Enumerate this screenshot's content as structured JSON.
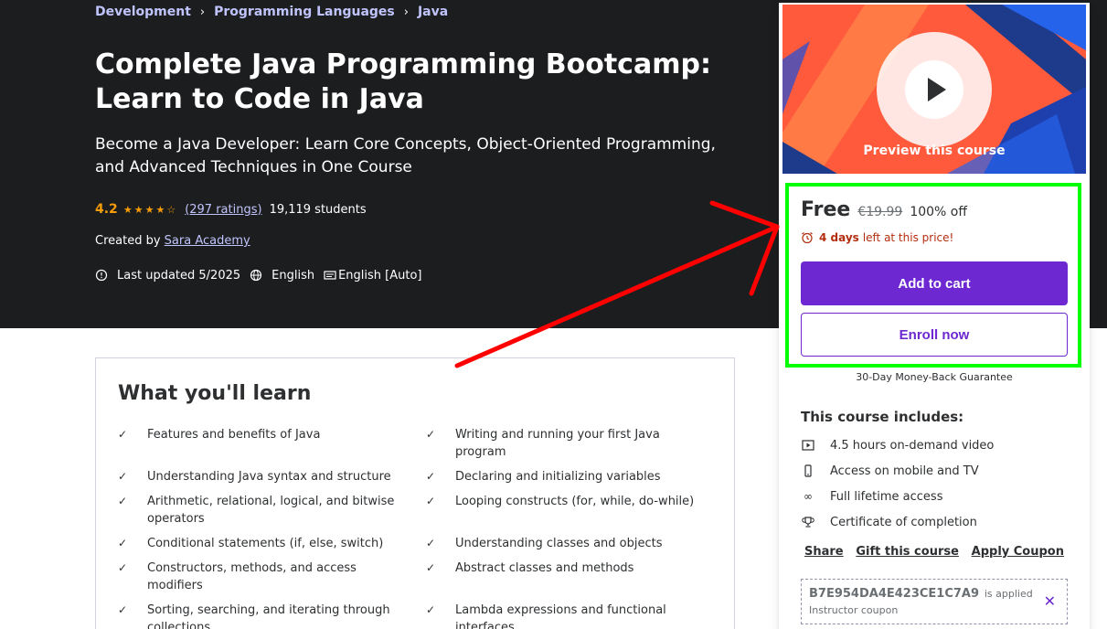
{
  "breadcrumb": [
    "Development",
    "Programming Languages",
    "Java"
  ],
  "course": {
    "title": "Complete Java Programming Bootcamp: Learn to Code in Java",
    "subtitle": "Become a Java Developer: Learn Core Concepts, Object-Oriented Programming, and Advanced Techniques in One Course",
    "rating": "4.2",
    "ratings_link": "(297 ratings)",
    "students": "19,119 students",
    "created_by_label": "Created by",
    "author": "Sara Academy",
    "updated": "Last updated 5/2025",
    "language": "English",
    "captions": "English [Auto]"
  },
  "learn": {
    "heading": "What you'll learn",
    "items": [
      "Features and benefits of Java",
      "Writing and running your first Java program",
      "Understanding Java syntax and structure",
      "Declaring and initializing variables",
      "Arithmetic, relational, logical, and bitwise operators",
      "Looping constructs (for, while, do-while)",
      "Conditional statements (if, else, switch)",
      "Understanding classes and objects",
      "Constructors, methods, and access modifiers",
      "Abstract classes and methods",
      "Sorting, searching, and iterating through collections",
      "Lambda expressions and functional interfaces"
    ]
  },
  "sidebar": {
    "preview_label": "Preview this course",
    "price": "Free",
    "original_price": "€19.99",
    "discount": "100% off",
    "timer_bold": "4 days",
    "timer_rest": "left at this price!",
    "add_to_cart": "Add to cart",
    "enroll": "Enroll now",
    "guarantee": "30-Day Money-Back Guarantee",
    "includes_title": "This course includes:",
    "includes": [
      {
        "icon": "video-icon",
        "label": "4.5 hours on-demand video"
      },
      {
        "icon": "mobile-icon",
        "label": "Access on mobile and TV"
      },
      {
        "icon": "infinity-icon",
        "label": "Full lifetime access"
      },
      {
        "icon": "trophy-icon",
        "label": "Certificate of completion"
      }
    ],
    "share": "Share",
    "gift": "Gift this course",
    "apply_coupon": "Apply Coupon",
    "coupon_code": "B7E954DA4E423CE1C7A9",
    "coupon_applied": "is applied",
    "coupon_type": "Instructor coupon"
  },
  "colors": {
    "accent": "#6d28d2",
    "highlight": "#00ff00",
    "annotation_arrow": "#ff0000",
    "star": "#f69c08"
  }
}
